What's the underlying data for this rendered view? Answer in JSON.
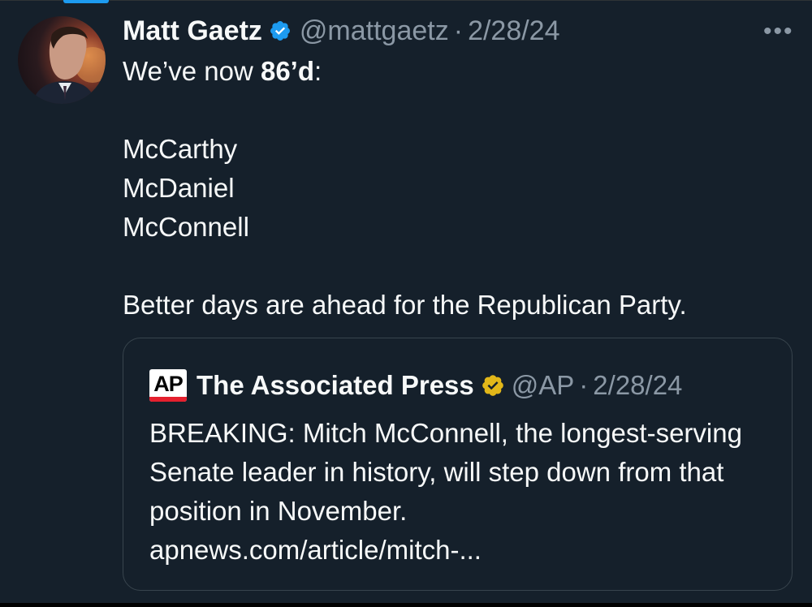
{
  "tweet": {
    "author_name": "Matt Gaetz",
    "handle": "@mattgaetz",
    "separator": "·",
    "date": "2/28/24",
    "more_label": "•••",
    "line1_prefix": "We’ve now ",
    "line1_bold": "86’d",
    "line1_suffix": ":",
    "names": [
      "McCarthy",
      "McDaniel",
      "McConnell"
    ],
    "closing": "Better days are ahead for the Republican Party."
  },
  "quote": {
    "logo_text": "AP",
    "author_name": "The Associated Press",
    "handle": "@AP",
    "separator": "·",
    "date": "2/28/24",
    "text": "BREAKING: Mitch McConnell, the longest-serving Senate leader in history, will step down from that position in November.",
    "link": "apnews.com/article/mitch-..."
  },
  "colors": {
    "background": "#15202b",
    "verified_blue": "#1d9bf0",
    "verified_gold": "#e2b719",
    "muted_text": "#8b98a5",
    "border": "#38444d"
  },
  "icons": {
    "verified": "verified-badge-icon",
    "org_verified": "gold-verified-badge-icon",
    "more": "more-options-icon"
  }
}
